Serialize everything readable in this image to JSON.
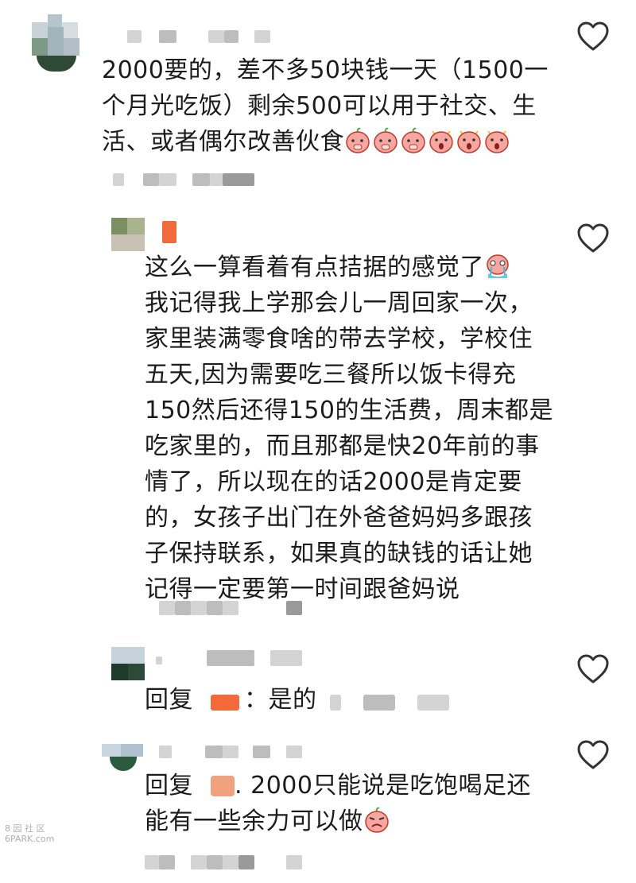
{
  "comments": [
    {
      "text_lines": [
        "2000要的，差不多50块钱一天（1500一",
        "个月光吃饭）剩余500可以用于社交、生",
        "活、或者偶尔改善伙食"
      ],
      "emoji_icons": [
        "peach-cover-face-emoji",
        "peach-cover-face-emoji",
        "peach-cover-face-emoji",
        "peach-surprised-emoji",
        "peach-surprised-emoji",
        "peach-surprised-emoji"
      ]
    },
    {
      "text_lines": [
        "这么一算看着有点拮据的感觉了",
        "我记得我上学那会儿一周回家一次，",
        "家里装满零食啥的带去学校，学校住",
        "五天,因为需要吃三餐所以饭卡得充",
        "150然后还得150的生活费，周末都是",
        "吃家里的，而且那都是快20年前的事",
        "情了，所以现在的话2000是肯定要",
        "的，女孩子出门在外爸爸妈妈多跟孩",
        "子保持联系，如果真的缺钱的话让她",
        "记得一定要第一时间跟爸妈说"
      ],
      "emoji_icons": [
        "peach-crying-emoji"
      ]
    },
    {
      "reply_prefix": "回复",
      "reply_text": "：是的"
    },
    {
      "reply_prefix": "回复",
      "text_lines": [
        ". 2000只能说是吃饱喝足还",
        "能有一些余力可以做"
      ],
      "emoji_icons": [
        "peach-angry-emoji"
      ]
    }
  ],
  "icons": {
    "like": "heart-outline-icon"
  },
  "watermark": {
    "line1": "8 园 社 区",
    "line2": "6PARK.com"
  }
}
